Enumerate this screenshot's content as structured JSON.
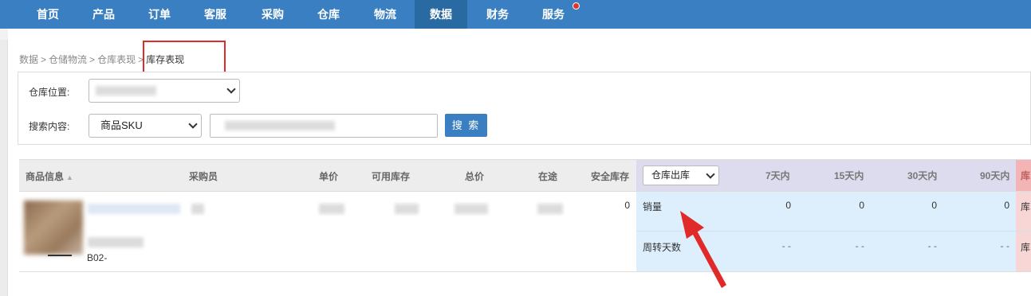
{
  "nav": {
    "items": [
      "首页",
      "产品",
      "订单",
      "客服",
      "采购",
      "仓库",
      "物流",
      "数据",
      "财务",
      "服务"
    ],
    "active": "数据",
    "colors": {
      "bar": "#3a7fc1",
      "active": "#2a6aa3",
      "badge": "#e0322f"
    }
  },
  "breadcrumb": [
    "数据",
    "仓储物流",
    "仓库表现",
    "库存表现"
  ],
  "filters": {
    "warehouse_label": "仓库位置:",
    "search_label": "搜索内容:",
    "search_type": "商品SKU",
    "search_button": "搜 索"
  },
  "table": {
    "headers": {
      "product": "商品信息",
      "buyer": "采购员",
      "unit_price": "单价",
      "available": "可用库存",
      "total": "总价",
      "in_transit": "在途",
      "safety_stock": "安全库存",
      "period_select": "仓库出库",
      "d7": "7天内",
      "d15": "15天内",
      "d30": "30天内",
      "d90": "90天内",
      "cut": "库"
    },
    "row": {
      "sku_partial": "B02-",
      "safety_stock": "0",
      "metrics": [
        {
          "label": "销量",
          "d7": "0",
          "d15": "0",
          "d30": "0",
          "d90": "0",
          "cut": "库"
        },
        {
          "label": "周转天数",
          "d7": "- -",
          "d15": "- -",
          "d30": "- -",
          "d90": "- -",
          "cut": "库"
        }
      ]
    }
  }
}
